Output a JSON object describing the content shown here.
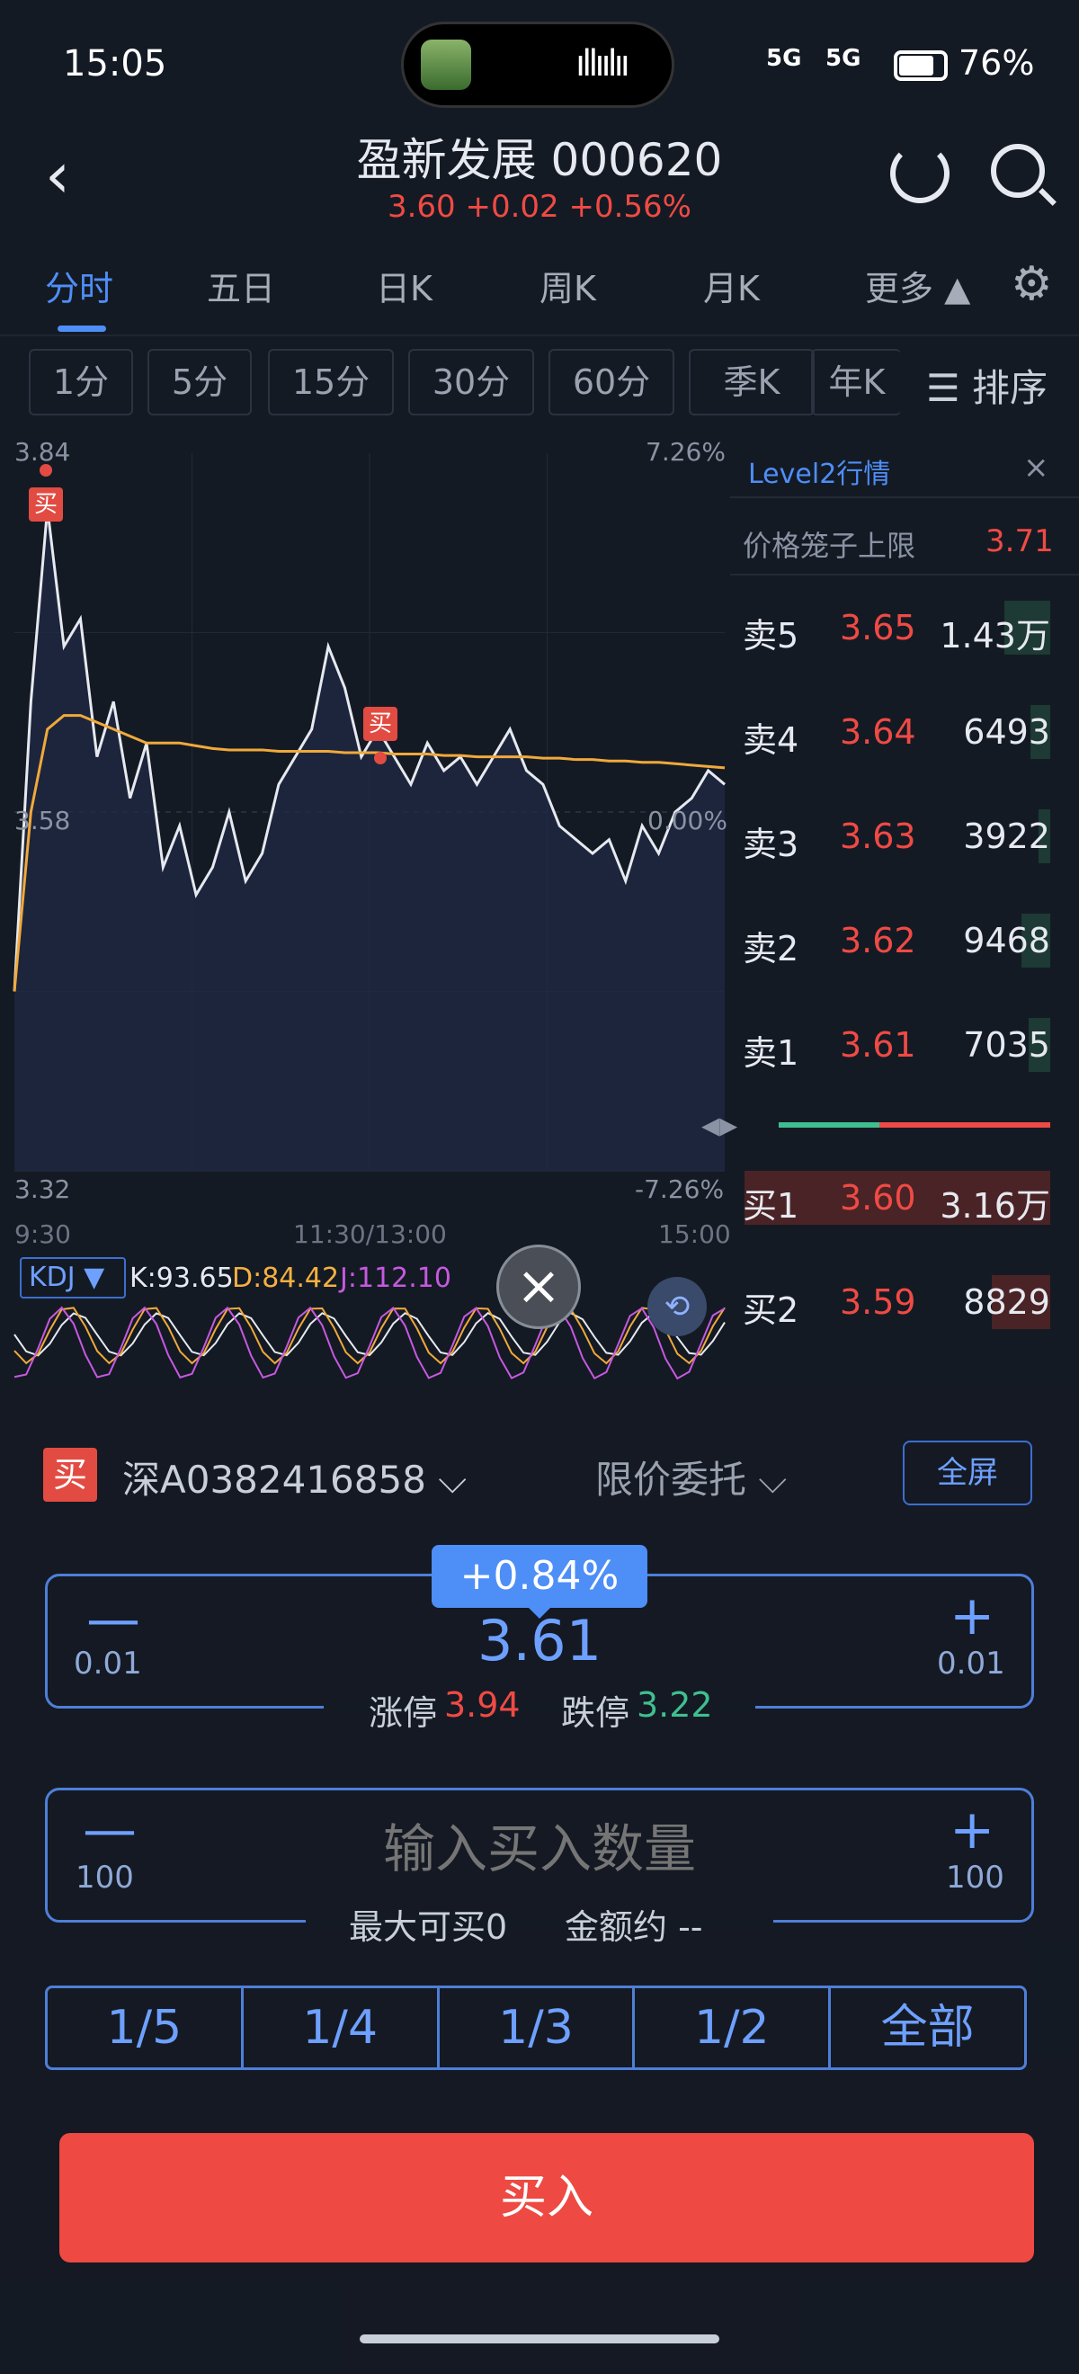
{
  "status": {
    "time": "15:05",
    "signal1": "5G",
    "signal2": "5G",
    "battery": "76%"
  },
  "header": {
    "title": "盈新发展 000620",
    "quote": "3.60 +0.02 +0.56%"
  },
  "tabs": [
    "分时",
    "五日",
    "日K",
    "周K",
    "月K",
    "更多 ▲"
  ],
  "intervals": [
    "1分",
    "5分",
    "15分",
    "30分",
    "60分",
    "季K",
    "年K"
  ],
  "sort_label": "排序",
  "chart": {
    "top_price": "3.84",
    "top_pct": "7.26%",
    "mid_price": "3.58",
    "mid_pct": "0.00%",
    "bottom_price": "3.32",
    "bottom_pct": "-7.26%",
    "time_start": "9:30",
    "time_mid": "11:30/13:00",
    "time_end": "15:00",
    "buy_marker": "买"
  },
  "chart_data": {
    "type": "line",
    "series": [
      {
        "values": [
          3.45,
          3.66,
          3.8,
          3.7,
          3.72,
          3.62,
          3.66,
          3.59,
          3.63,
          3.54,
          3.57,
          3.52,
          3.54,
          3.58,
          3.53,
          3.55,
          3.6,
          3.62,
          3.64,
          3.7,
          3.67,
          3.62,
          3.64,
          3.62,
          3.6,
          3.63,
          3.61,
          3.62,
          3.6,
          3.62,
          3.64,
          3.61,
          3.6,
          3.57,
          3.56,
          3.55,
          3.56,
          3.53,
          3.57,
          3.55,
          3.58,
          3.59,
          3.61,
          3.6
        ]
      },
      {
        "values": [
          3.45,
          3.58,
          3.64,
          3.65,
          3.65,
          3.645,
          3.64,
          3.635,
          3.63,
          3.63,
          3.63,
          3.628,
          3.626,
          3.625,
          3.625,
          3.625,
          3.624,
          3.624,
          3.624,
          3.624,
          3.623,
          3.623,
          3.623,
          3.622,
          3.622,
          3.622,
          3.621,
          3.621,
          3.62,
          3.62,
          3.62,
          3.62,
          3.619,
          3.619,
          3.618,
          3.618,
          3.617,
          3.617,
          3.616,
          3.616,
          3.615,
          3.614,
          3.613,
          3.612
        ]
      }
    ],
    "ylim": [
      3.32,
      3.84
    ],
    "colors": {
      "price": "#e6e9ef",
      "avg": "#f0a93a",
      "area": "#24324f"
    }
  },
  "kdj": {
    "label": "KDJ ▼",
    "k": "K:93.65",
    "d": "D:84.42",
    "j": "J:112.10"
  },
  "level2": {
    "title": "Level2行情",
    "cage_label": "价格笼子上限",
    "cage_value": "3.71",
    "asks": [
      {
        "label": "卖5",
        "price": "3.65",
        "vol": "1.43万",
        "bar": 0.32
      },
      {
        "label": "卖4",
        "price": "3.64",
        "vol": "6493",
        "bar": 0.14
      },
      {
        "label": "卖3",
        "price": "3.63",
        "vol": "3922",
        "bar": 0.08
      },
      {
        "label": "卖2",
        "price": "3.62",
        "vol": "9468",
        "bar": 0.2
      },
      {
        "label": "卖1",
        "price": "3.61",
        "vol": "7035",
        "bar": 0.15
      }
    ],
    "bids": [
      {
        "label": "买1",
        "price": "3.60",
        "vol": "3.16万",
        "bar": 1.0
      },
      {
        "label": "买2",
        "price": "3.59",
        "vol": "8829",
        "bar": 0.19
      }
    ],
    "ratio_green": 0.37
  },
  "trade": {
    "side": "买",
    "account": "深A0382416858 ⌵",
    "order_type": "限价委托 ⌵",
    "fullscreen": "全屏",
    "pct_change": "+0.84%",
    "price_minus": "—",
    "price_plus": "+",
    "price_step": "0.01",
    "price": "3.61",
    "limit_up_label": "涨停",
    "limit_up_value": "3.94",
    "limit_down_label": "跌停",
    "limit_down_value": "3.22",
    "qty_minus": "—",
    "qty_plus": "+",
    "qty_step": "100",
    "qty_placeholder": "输入买入数量",
    "max_buy": "最大可买0",
    "amount": "金额约 --",
    "fractions": [
      "1/5",
      "1/4",
      "1/3",
      "1/2",
      "全部"
    ],
    "submit": "买入"
  }
}
